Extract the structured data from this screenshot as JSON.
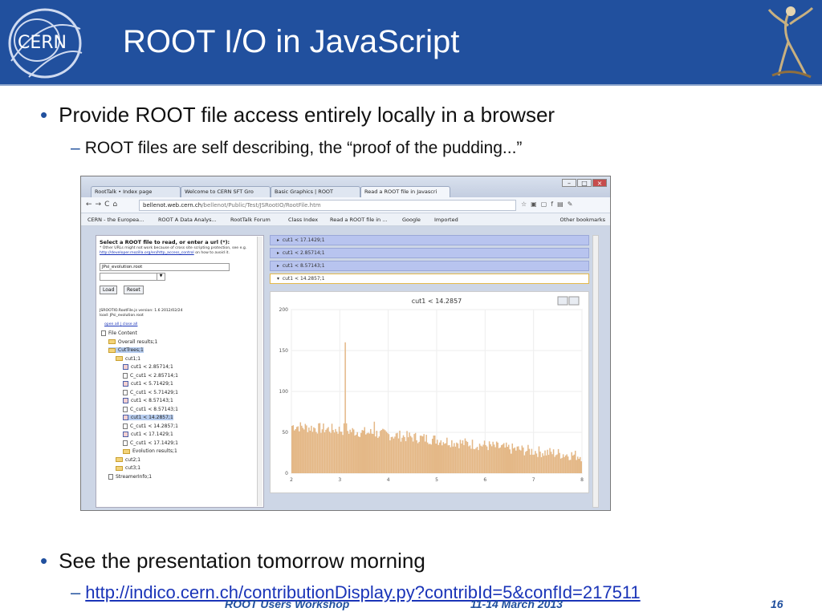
{
  "header": {
    "title": "ROOT I/O in JavaScript",
    "cern_logo_text": "CERN",
    "colors": {
      "band": "#21509e",
      "bullet": "#21509e",
      "hist_fill": "#e4b887"
    }
  },
  "bullets": [
    {
      "text": "Provide ROOT file access entirely locally in a browser",
      "sub": "ROOT files are self describing, the “proof of the pudding...”"
    },
    {
      "text": "See the presentation tomorrow morning",
      "sub_link": "http://indico.cern.ch/contributionDisplay.py?contribId=5&confId=217511"
    }
  ],
  "footer": {
    "left": "ROOT Users Workshop",
    "mid": "11-14 March 2013",
    "page": "16"
  },
  "browser": {
    "tabs": [
      "RootTalk • Index page",
      "Welcome to CERN SFT Gro",
      "Basic Graphics | ROOT",
      "Read a ROOT file in Javascri"
    ],
    "url_host": "bellenot.web.cern.ch",
    "url_path": "/bellenot/Public/Test/JSRootIO/RootFile.htm",
    "bookmarks": [
      "CERN - the Europea...",
      "ROOT A Data Analys...",
      "RootTalk Forum",
      "Class Index",
      "Read a ROOT file in ...",
      "Google",
      "Imported"
    ],
    "other_bookmarks": "Other bookmarks",
    "left_panel": {
      "heading": "Select a ROOT file to read, or enter a url (*):",
      "note": "* Other URLs might not work because of cross site scripting protection, see e.g.",
      "note_link": "http://developer.mozilla.org/en/http_access_control",
      "note_tail": "on how to avoid it.",
      "input_value": "JPsi_evolution.root",
      "load_button": "Load",
      "reset_button": "Reset",
      "version_line": "JSROOTIO.RootFile.js version: 1.6 2012/02/24",
      "loaded_line": "load: JPsi_evolution.root",
      "open_all": "open all",
      "close_all": "close all",
      "tree": [
        {
          "label": "File Content",
          "icon": "root-file-icon",
          "depth": 0
        },
        {
          "label": "Overall results;1",
          "icon": "folder-icon",
          "depth": 1
        },
        {
          "label": "CutTrees;1",
          "icon": "folder-icon",
          "depth": 1,
          "selected": true
        },
        {
          "label": "cut1;1",
          "icon": "folder-icon",
          "depth": 2
        },
        {
          "label": "cut1 < 2.85714;1",
          "icon": "histogram-icon",
          "depth": 3
        },
        {
          "label": "C_cut1 < 2.85714;1",
          "icon": "page-icon",
          "depth": 3
        },
        {
          "label": "cut1 < 5.71429;1",
          "icon": "histogram-icon",
          "depth": 3
        },
        {
          "label": "C_cut1 < 5.71429;1",
          "icon": "page-icon",
          "depth": 3
        },
        {
          "label": "cut1 < 8.57143;1",
          "icon": "histogram-icon",
          "depth": 3
        },
        {
          "label": "C_cut1 < 8.57143;1",
          "icon": "page-icon",
          "depth": 3
        },
        {
          "label": "cut1 < 14.2857;1",
          "icon": "histogram-icon",
          "depth": 3,
          "selected": true
        },
        {
          "label": "C_cut1 < 14.2857;1",
          "icon": "page-icon",
          "depth": 3
        },
        {
          "label": "cut1 < 17.1429;1",
          "icon": "histogram-icon",
          "depth": 3
        },
        {
          "label": "C_cut1 < 17.1429;1",
          "icon": "page-icon",
          "depth": 3
        },
        {
          "label": "Evolution results;1",
          "icon": "folder-icon",
          "depth": 3
        },
        {
          "label": "cut2;1",
          "icon": "folder-icon",
          "depth": 2
        },
        {
          "label": "cut3;1",
          "icon": "folder-icon",
          "depth": 2
        },
        {
          "label": "StreamerInfo;1",
          "icon": "streamer-icon",
          "depth": 1
        }
      ]
    },
    "right_panel": {
      "accordion": [
        "cut1 < 17.1429;1",
        "cut1 < 2.85714;1",
        "cut1 < 8.57143;1",
        "cut1 < 14.2857;1"
      ],
      "open_index": 3
    }
  },
  "chart_data": {
    "type": "bar",
    "title": "cut1 < 14.2857",
    "xlim": [
      2,
      8
    ],
    "ylim": [
      0,
      200
    ],
    "x_ticks": [
      2,
      3,
      4,
      5,
      6,
      7,
      8
    ],
    "y_ticks": [
      0,
      50,
      100,
      150,
      200
    ],
    "grid": true,
    "bin_width": 0.025,
    "peaks": [
      {
        "x": 3.1,
        "y": 160
      },
      {
        "x": 3.7,
        "y": 63
      }
    ],
    "envelope": [
      {
        "x": 2.0,
        "y": 58
      },
      {
        "x": 2.5,
        "y": 55
      },
      {
        "x": 3.0,
        "y": 53
      },
      {
        "x": 3.5,
        "y": 50
      },
      {
        "x": 4.0,
        "y": 47
      },
      {
        "x": 4.5,
        "y": 44
      },
      {
        "x": 5.0,
        "y": 41
      },
      {
        "x": 5.5,
        "y": 37
      },
      {
        "x": 6.0,
        "y": 34
      },
      {
        "x": 6.5,
        "y": 30
      },
      {
        "x": 7.0,
        "y": 27
      },
      {
        "x": 7.5,
        "y": 24
      },
      {
        "x": 8.0,
        "y": 21
      }
    ]
  }
}
